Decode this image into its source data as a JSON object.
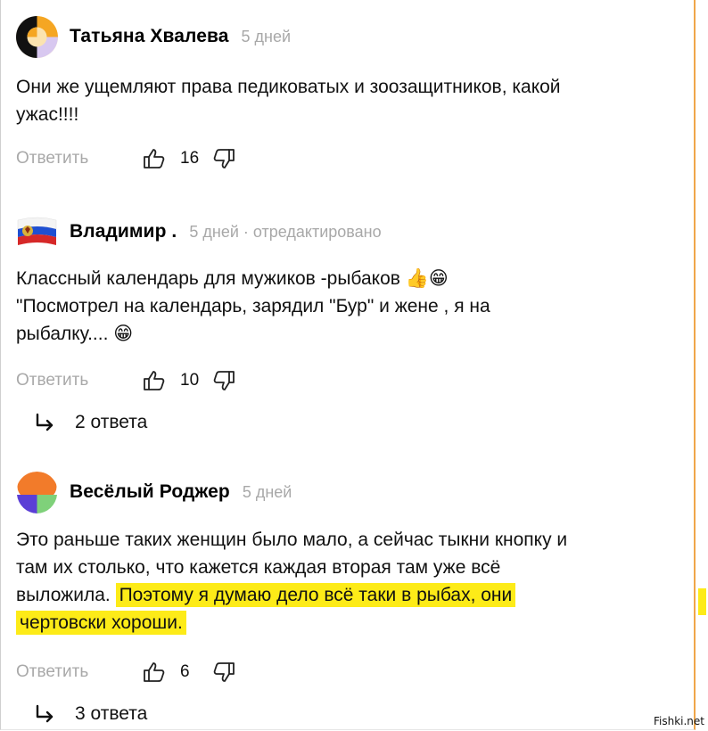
{
  "comments": [
    {
      "author": "Татьяна Хвалева",
      "meta": "5 дней",
      "text": "Они же ущемляют права педиковатых и зоозащитников, какой ужас!!!!",
      "reply_label": "Ответить",
      "likes": "16"
    },
    {
      "author": "Владимир .",
      "meta": "5 дней · отредактировано",
      "text_before": "Классный календарь для мужиков -рыбаков 👍😁 \"Посмотрел на календарь, зарядил \"Бур\" и жене , я на рыбалку.... 😁",
      "reply_label": "Ответить",
      "likes": "10",
      "answers": "2 ответа"
    },
    {
      "author": "Весёлый Роджер",
      "meta": "5 дней",
      "text_plain": "Это раньше таких женщин было мало, а сейчас тыкни кнопку и там их столько, что кажется каждая вторая там уже всё выложила.",
      "text_highlight": "Поэтому я думаю дело всё таки в рыбах, они чертовски хороши.",
      "reply_label": "Ответить",
      "likes": "6",
      "answers": "3 ответа"
    }
  ],
  "colors": {
    "highlight": "#fdeb18",
    "muted_text": "#a9a9a9",
    "frame_accent": "#f0a64a"
  },
  "icons": [
    "thumbs-up-icon",
    "thumbs-down-icon",
    "reply-arrow-icon"
  ],
  "watermark": "Fishki.net"
}
